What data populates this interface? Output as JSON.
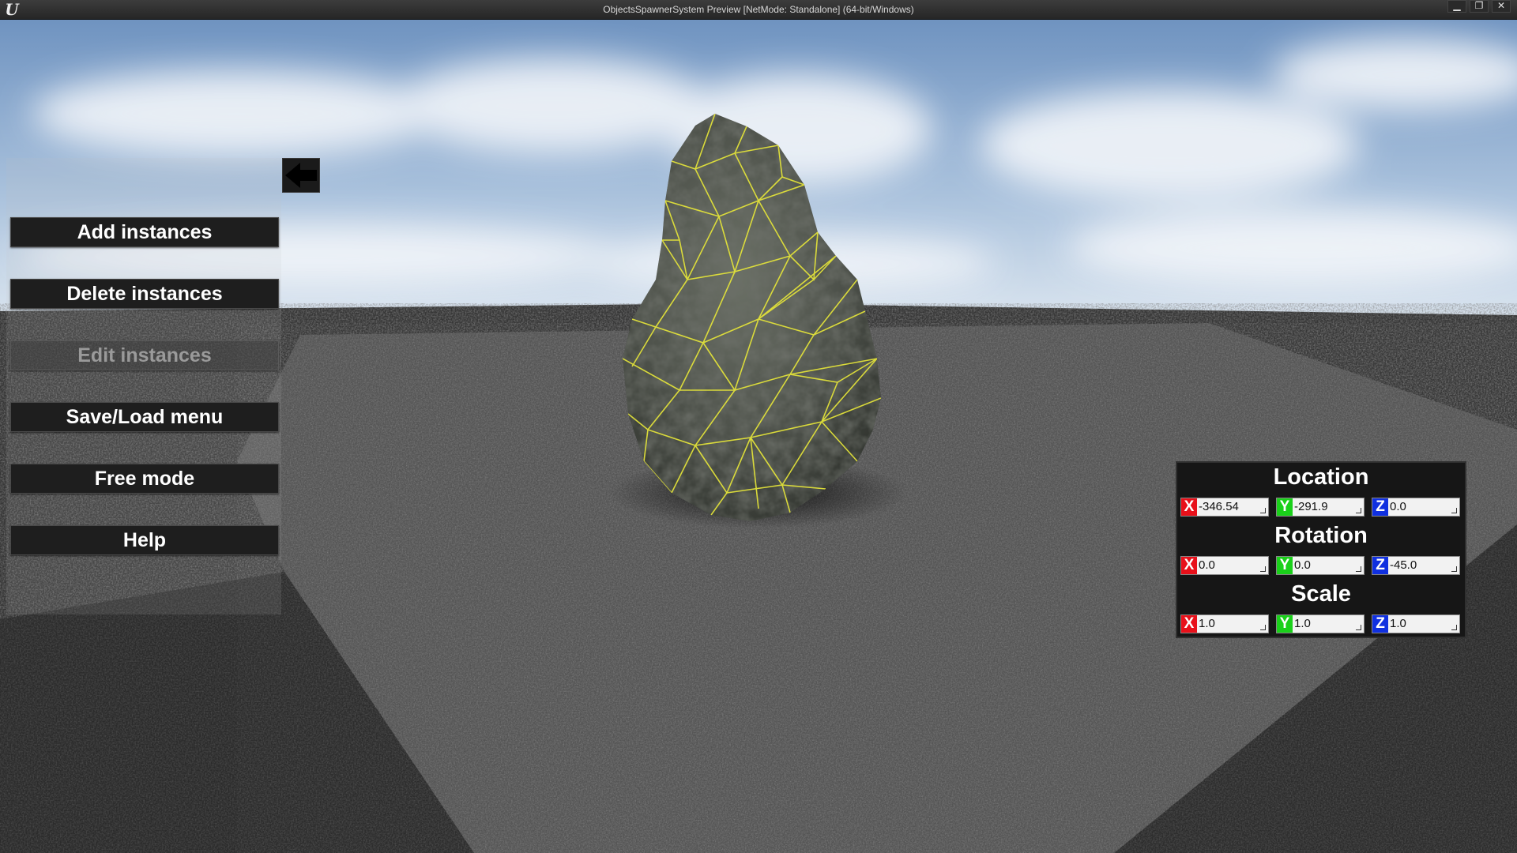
{
  "window": {
    "title": "ObjectsSpawnerSystem Preview [NetMode: Standalone]  (64-bit/Windows)",
    "logo": "U",
    "minimize_glyph": "▁",
    "maximize_glyph": "❐",
    "close_glyph": "✕"
  },
  "menu": {
    "items": [
      {
        "label": "Add instances",
        "enabled": true
      },
      {
        "label": "Delete instances",
        "enabled": true
      },
      {
        "label": "Edit instances",
        "enabled": false
      },
      {
        "label": "Save/Load menu",
        "enabled": true
      },
      {
        "label": "Free mode",
        "enabled": true
      },
      {
        "label": "Help",
        "enabled": true
      }
    ]
  },
  "transform": {
    "location": {
      "title": "Location",
      "x": "-346.54",
      "y": "-291.9",
      "z": "0.0"
    },
    "rotation": {
      "title": "Rotation",
      "x": "0.0",
      "y": "0.0",
      "z": "-45.0"
    },
    "scale": {
      "title": "Scale",
      "x": "1.0",
      "y": "1.0",
      "z": "1.0"
    }
  },
  "axis_labels": {
    "x": "X",
    "y": "Y",
    "z": "Z"
  },
  "colors": {
    "axis_x": "#e8101a",
    "axis_y": "#1ad01a",
    "axis_z": "#1030e0",
    "wireframe": "#e2e23a"
  }
}
